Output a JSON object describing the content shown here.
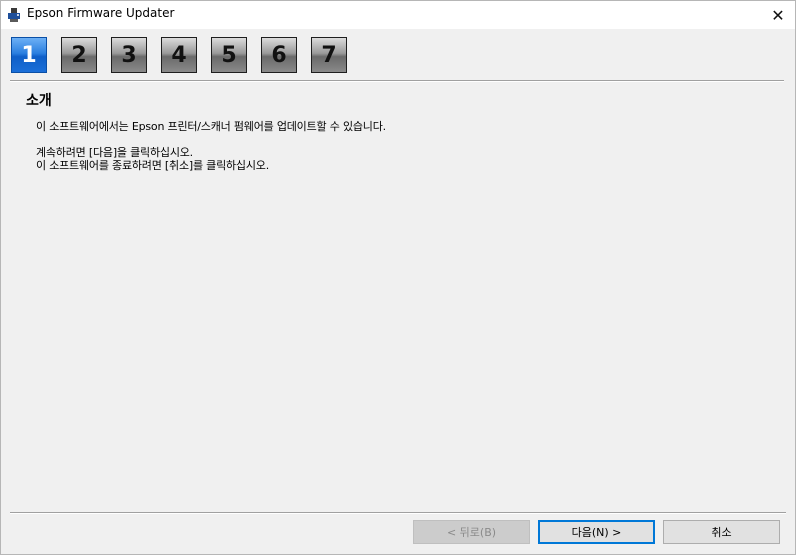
{
  "window": {
    "title": "Epson Firmware Updater"
  },
  "steps": [
    "1",
    "2",
    "3",
    "4",
    "5",
    "6",
    "7"
  ],
  "active_step": 1,
  "section": {
    "title": "소개"
  },
  "body": {
    "line1": "이 소프트웨어에서는 Epson 프린터/스캐너 펌웨어를 업데이트할 수 있습니다.",
    "line2": "계속하려면 [다음]을 클릭하십시오.",
    "line3": "이 소프트웨어를 종료하려면 [취소]를 클릭하십시오."
  },
  "buttons": {
    "back": "< 뒤로(B)",
    "next": "다음(N) >",
    "cancel": "취소"
  },
  "icons": {
    "app": "epson-updater-icon",
    "close": "close-icon"
  },
  "colors": {
    "active_step": "#1a6ed8",
    "default_button_border": "#0078d7"
  }
}
